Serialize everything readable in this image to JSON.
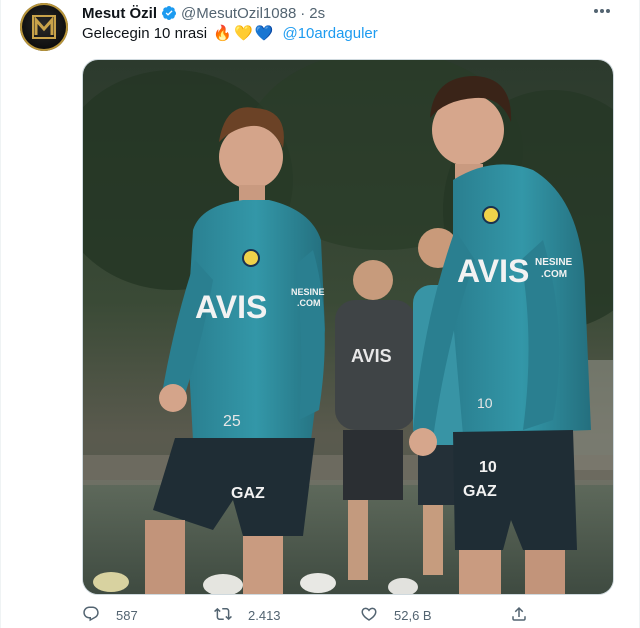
{
  "author": {
    "display_name": "Mesut Özil",
    "handle": "@MesutOzil1088",
    "separator": "·",
    "time": "2s"
  },
  "tweet": {
    "text": "Gelecegin 10 nrasi",
    "emojis": [
      "🔥",
      "💛",
      "💙"
    ],
    "mention": "@10ardaguler"
  },
  "photo": {
    "sponsor_left": "AVIS",
    "number_left": "25",
    "shorts_brand_left": "GAZ",
    "sleeve_brand": "NESINE COM",
    "sponsor_right": "AVIS",
    "number_right": "10",
    "shorts_brand_right": "GAZ",
    "sleeve_brand_right": "NESINE COM"
  },
  "actions": {
    "replies": "587",
    "retweets": "2.413",
    "likes": "52,6 B"
  },
  "colors": {
    "accent": "#1d9bf0",
    "text_secondary": "#536471",
    "jersey": "#2f8a9b"
  },
  "icons": {
    "verified": "verified-badge-icon",
    "more": "more-dots-icon",
    "reply": "reply-icon",
    "retweet": "retweet-icon",
    "like": "heart-icon",
    "share": "share-icon"
  }
}
